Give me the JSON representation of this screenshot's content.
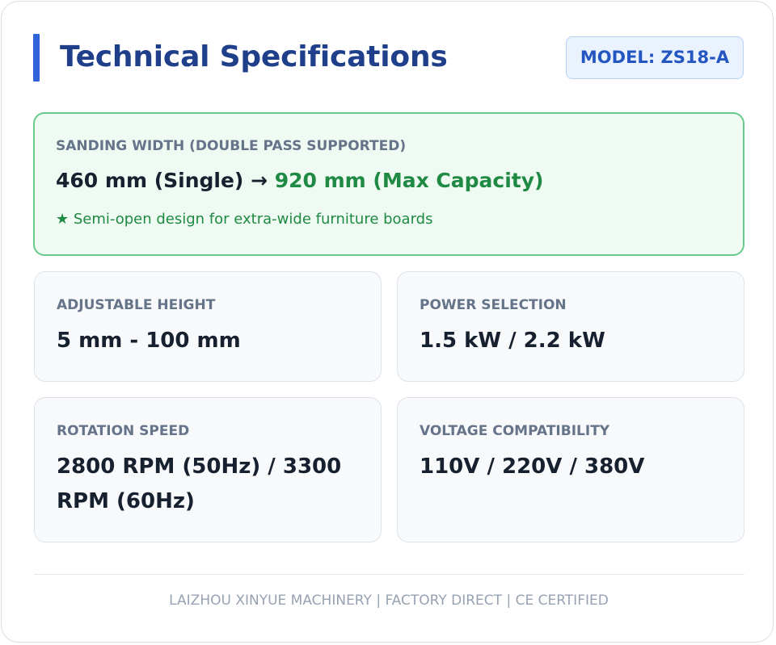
{
  "header": {
    "title": "Technical Specifications",
    "model_badge": "MODEL: ZS18-A"
  },
  "highlight": {
    "label": "SANDING WIDTH (DOUBLE PASS SUPPORTED)",
    "value_single": "460 mm (Single)",
    "arrow": "→",
    "value_max": "920 mm (Max Capacity)",
    "note": "★ Semi-open design for extra-wide furniture boards"
  },
  "specs": [
    {
      "label": "ADJUSTABLE HEIGHT",
      "value": "5 mm - 100 mm"
    },
    {
      "label": "POWER SELECTION",
      "value": "1.5 kW / 2.2 kW"
    },
    {
      "label": "ROTATION SPEED",
      "value": "2800 RPM (50Hz) / 3300 RPM (60Hz)"
    },
    {
      "label": "VOLTAGE COMPATIBILITY",
      "value": "110V / 220V / 380V"
    }
  ],
  "footer": "LAIZHOU XINYUE MACHINERY | FACTORY DIRECT | CE CERTIFIED",
  "colors": {
    "accent": "#2f63d9",
    "title": "#1f3f8a",
    "highlight_green": "#1f8a43"
  }
}
